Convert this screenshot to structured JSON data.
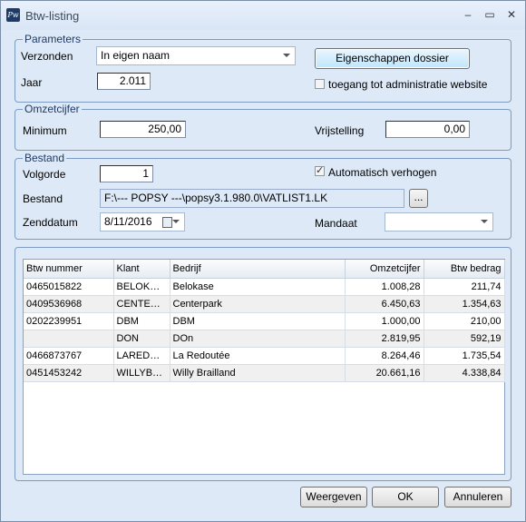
{
  "window": {
    "title": "Btw-listing",
    "icon": "popsy-app-icon",
    "app_icon_text": "Pw",
    "minimize": "–",
    "maximize": "▭",
    "close": "✕"
  },
  "parameters": {
    "legend": "Parameters",
    "verzonden_label": "Verzonden",
    "verzonden_value": "In eigen naam",
    "jaar_label": "Jaar",
    "jaar_value": "2.011",
    "eigenschappen_button": "Eigenschappen dossier",
    "toegang_label": "toegang tot administratie website",
    "toegang_checked": false
  },
  "omzetcijfer": {
    "legend": "Omzetcijfer",
    "minimum_label": "Minimum",
    "minimum_value": "250,00",
    "vrijstelling_label": "Vrijstelling",
    "vrijstelling_value": "0,00"
  },
  "bestand": {
    "legend": "Bestand",
    "volgorde_label": "Volgorde",
    "volgorde_value": "1",
    "auto_label": "Automatisch verhogen",
    "auto_checked": true,
    "bestand_label": "Bestand",
    "bestand_value": "F:\\--- POPSY ---\\popsy3.1.980.0\\VATLIST1.LK",
    "browse_button": "...",
    "zenddatum_label": "Zenddatum",
    "zenddatum_value": "8/11/2016",
    "mandaat_label": "Mandaat",
    "mandaat_value": ""
  },
  "table": {
    "columns": [
      "Btw nummer",
      "Klant",
      "Bedrijf",
      "Omzetcijfer",
      "Btw bedrag"
    ],
    "rows": [
      [
        "0465015822",
        "BELOKAZE",
        "Belokase",
        "1.008,28",
        "211,74"
      ],
      [
        "0409536968",
        "CENTERP...",
        "Centerpark",
        "6.450,63",
        "1.354,63"
      ],
      [
        "0202239951",
        "DBM",
        "DBM",
        "1.000,00",
        "210,00"
      ],
      [
        "",
        "DON",
        "DOn",
        "2.819,95",
        "592,19"
      ],
      [
        "0466873767",
        "LAREDOUT",
        "La Redoutée",
        "8.264,46",
        "1.735,54"
      ],
      [
        "0451453242",
        "WILLYBRAI",
        "Willy Brailland",
        "20.661,16",
        "4.338,84"
      ]
    ]
  },
  "footer": {
    "weergeven": "Weergeven",
    "ok": "OK",
    "annuleren": "Annuleren"
  }
}
